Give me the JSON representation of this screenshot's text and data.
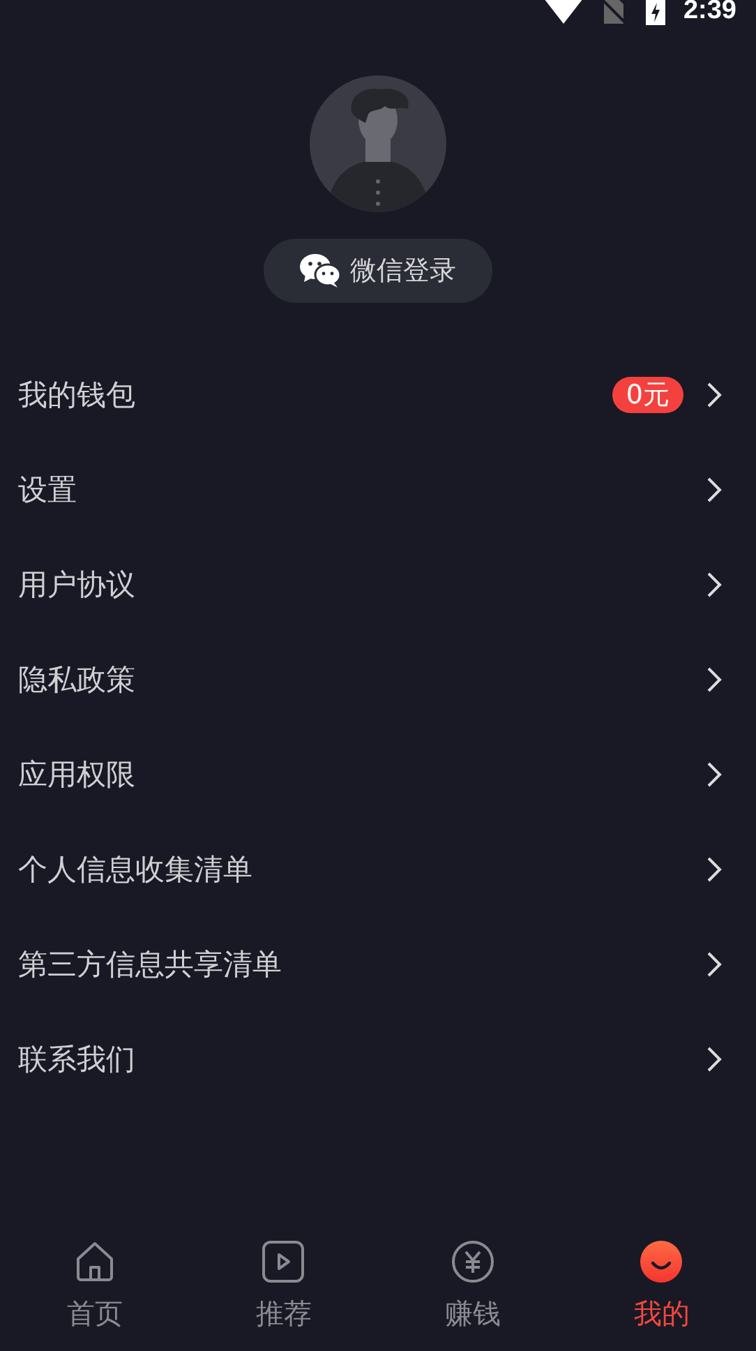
{
  "status_bar": {
    "time": "2:39"
  },
  "profile": {
    "login_button": "微信登录"
  },
  "menu": [
    {
      "label": "我的钱包",
      "badge": "0元"
    },
    {
      "label": "设置"
    },
    {
      "label": "用户协议"
    },
    {
      "label": "隐私政策"
    },
    {
      "label": "应用权限"
    },
    {
      "label": "个人信息收集清单"
    },
    {
      "label": "第三方信息共享清单"
    },
    {
      "label": "联系我们"
    }
  ],
  "tabs": [
    {
      "label": "首页",
      "kind": "home",
      "selected": false
    },
    {
      "label": "推荐",
      "kind": "play",
      "selected": false
    },
    {
      "label": "赚钱",
      "kind": "yen",
      "selected": false
    },
    {
      "label": "我的",
      "kind": "smile",
      "selected": true
    }
  ]
}
